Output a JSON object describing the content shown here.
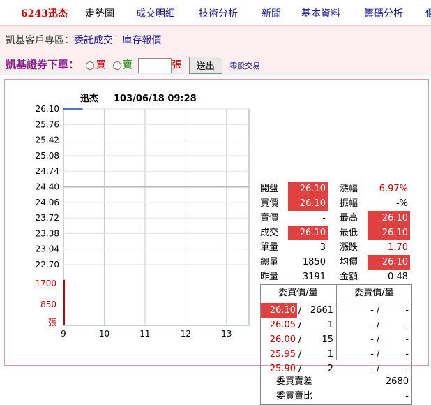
{
  "tabs": {
    "stock": "6243迅杰",
    "items": [
      "走勢圖",
      "成交明細",
      "技術分析",
      "新聞",
      "基本資料",
      "籌碼分析",
      "個"
    ]
  },
  "customer": {
    "prefix": "凱基客戶專區：",
    "link1": "委託成交",
    "link2": "庫存報價"
  },
  "order": {
    "title": "凱基證券下單：",
    "buy": "買",
    "sell": "賣",
    "unit": "張",
    "send": "送出",
    "odd": "零股交易"
  },
  "chart_data": {
    "type": "line",
    "title": "迅杰",
    "datetime": "103/06/18 09:28",
    "y_ticks": [
      "26.10",
      "25.76",
      "25.42",
      "25.08",
      "24.74",
      "24.40",
      "24.06",
      "23.72",
      "23.38",
      "23.04",
      "22.70"
    ],
    "volume_ticks": [
      "1700",
      "850",
      "張"
    ],
    "x_ticks": [
      "9",
      "10",
      "11",
      "12",
      "13"
    ],
    "reference_price": 24.4,
    "ylim": [
      22.7,
      26.1
    ],
    "price_series": {
      "x": [
        9.0,
        9.47
      ],
      "y": [
        26.1,
        26.1
      ]
    },
    "volume_series": {
      "x": [
        9.0
      ],
      "y": [
        1850
      ]
    },
    "volume_max": 1700
  },
  "quote": {
    "open_label": "開盤",
    "open": "26.10",
    "pct_label": "漲幅",
    "pct": "6.97%",
    "bid_label": "買價",
    "bid": "26.10",
    "amp_label": "振幅",
    "amp": "-%",
    "ask_label": "賣價",
    "ask": "-",
    "high_label": "最高",
    "high": "26.10",
    "last_label": "成交",
    "last": "26.10",
    "low_label": "最低",
    "low": "26.10",
    "qty_label": "單量",
    "qty": "3",
    "chg_label": "漲跌",
    "chg": "1.70",
    "vol_label": "總量",
    "vol": "1850",
    "avg_label": "均價",
    "avg": "26.10",
    "prev_label": "昨量",
    "prev": "3191",
    "amount_label": "金額",
    "amount": "0.48"
  },
  "book": {
    "bid_header": "委買價/量",
    "ask_header": "委賣價/量",
    "bids": [
      {
        "price": "26.10",
        "qty": "2661"
      },
      {
        "price": "26.05",
        "qty": "1"
      },
      {
        "price": "26.00",
        "qty": "15"
      },
      {
        "price": "25.95",
        "qty": "1"
      },
      {
        "price": "25.90",
        "qty": "2"
      }
    ],
    "asks": [
      {
        "price": "-",
        "qty": "-"
      },
      {
        "price": "-",
        "qty": "-"
      },
      {
        "price": "-",
        "qty": "-"
      },
      {
        "price": "-",
        "qty": "-"
      },
      {
        "price": "-",
        "qty": "-"
      }
    ],
    "diff_label": "委買賣差",
    "diff": "2680",
    "ratio_label": "委買賣比",
    "ratio": "-"
  },
  "colors": {
    "up": "#cc0000",
    "highlight": "#e04040",
    "link": "#1a1a9a",
    "pink": "#fdeef0"
  }
}
